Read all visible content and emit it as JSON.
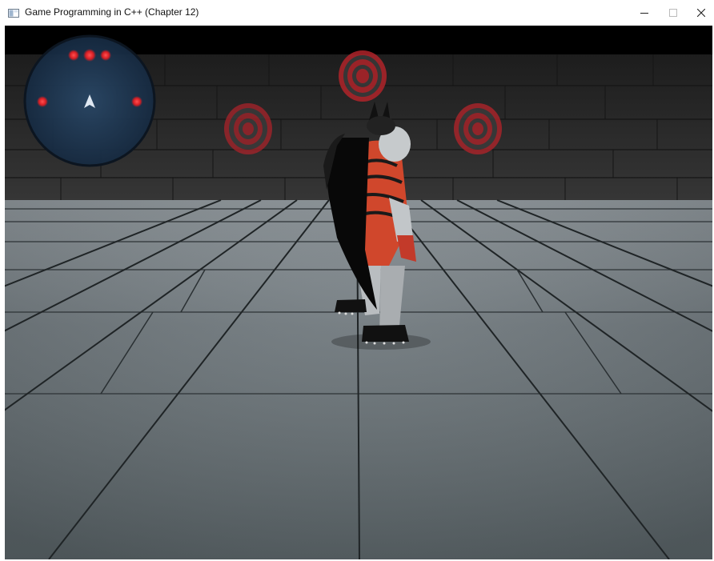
{
  "window": {
    "title": "Game Programming in C++ (Chapter 12)",
    "controls": {
      "minimize": "minimize-icon",
      "maximize": "maximize-icon",
      "close": "close-icon"
    }
  },
  "scene": {
    "sky_color": "#000000",
    "wall_color": "#2c2c2c",
    "floor_color": "#5f686d",
    "target_color": "#b8262a",
    "targets": 3
  },
  "hud": {
    "radar": {
      "fill_color": "#1e3650",
      "blip_color": "#e0242a",
      "player_arrow_color": "#dfe8f2"
    }
  },
  "player": {
    "suit_colors": [
      "#111111",
      "#d0472c",
      "#bfc3c6"
    ]
  }
}
